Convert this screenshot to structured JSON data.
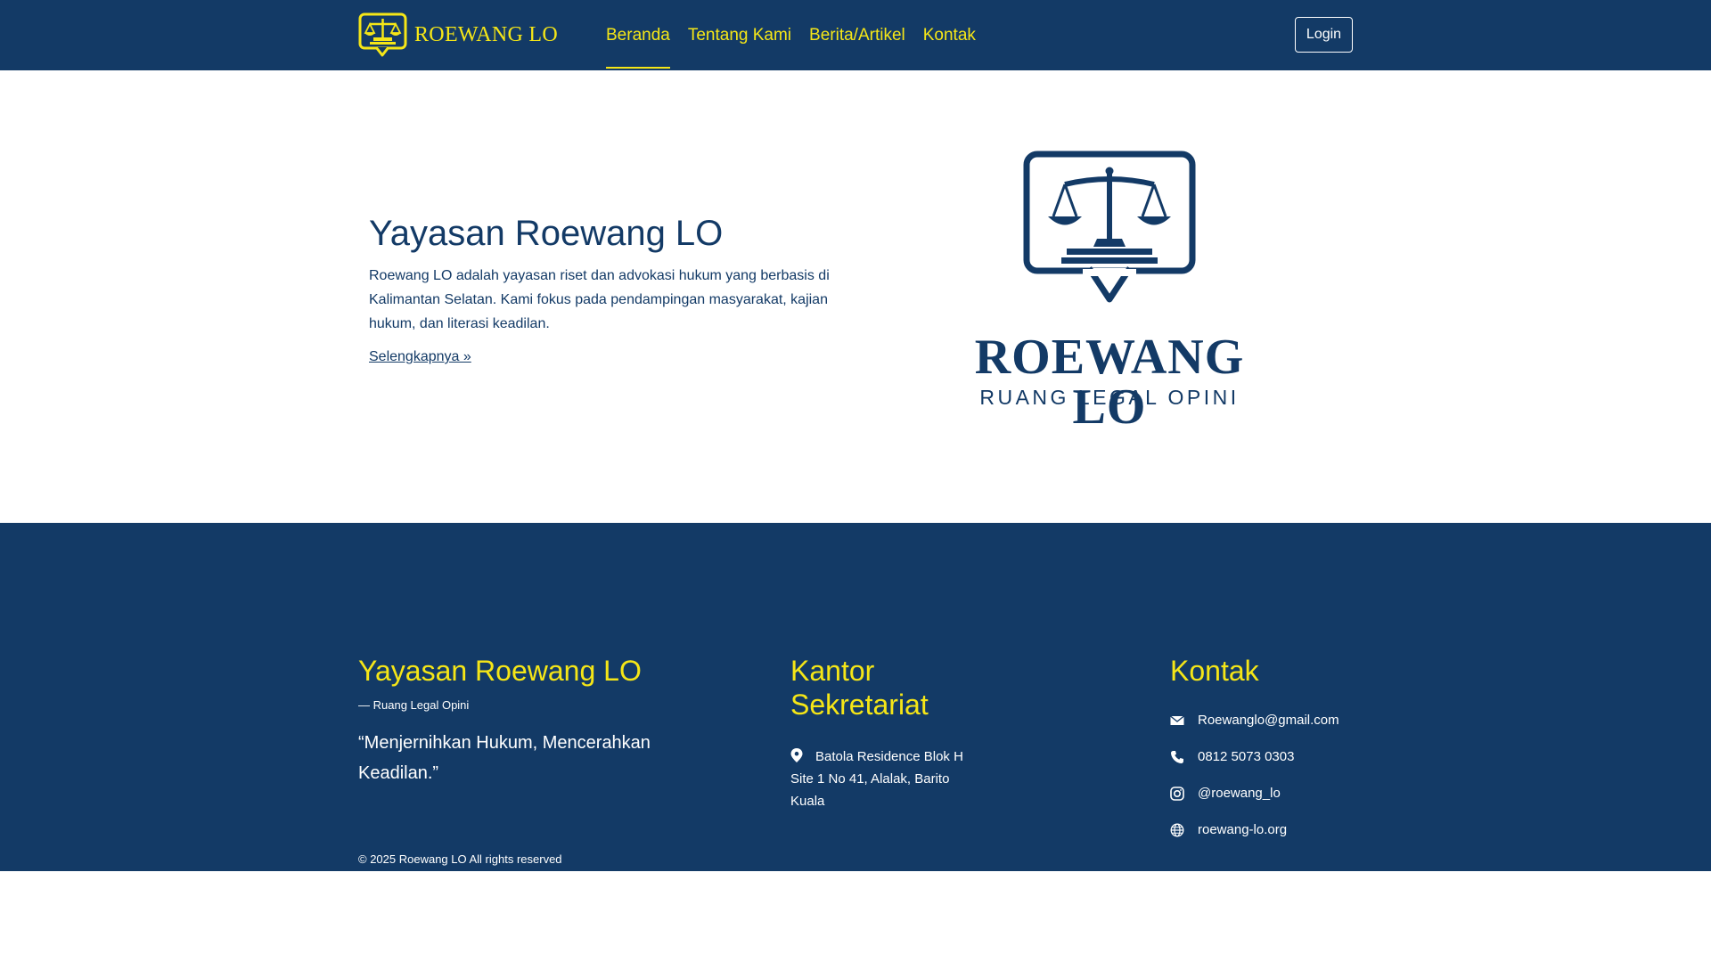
{
  "colors": {
    "primary": "#133a66",
    "accent": "#f5e617",
    "text_light": "#ffffff"
  },
  "navbar": {
    "brand": "ROEWANG LO",
    "brand_icon": "scales-speech-bubble-icon",
    "links": [
      {
        "label": "Beranda",
        "active": true
      },
      {
        "label": "Tentang Kami",
        "active": false
      },
      {
        "label": "Berita/Artikel",
        "active": false
      },
      {
        "label": "Kontak",
        "active": false
      }
    ],
    "login_label": "Login"
  },
  "hero": {
    "title": "Yayasan Roewang LO",
    "description": "Roewang LO adalah yayasan riset dan advokasi hukum yang berbasis di Kalimantan Selatan. Kami fokus pada pendampingan masyarakat, kajian hukum, dan literasi keadilan.",
    "more_label": "Selengkapnya »",
    "logo_title": "ROEWANG LO",
    "logo_subtitle": "RUANG LEGAL OPINI"
  },
  "footer": {
    "about": {
      "heading": "Yayasan Roewang LO",
      "tagline": "— Ruang Legal Opini",
      "quote": "“Menjernihkan Hukum, Mencerahkan Keadilan.”"
    },
    "office": {
      "heading": "Kantor Sekretariat",
      "address": "Batola Residence Blok H Site 1 No 41, Alalak, Barito Kuala",
      "address_icon": "map-pin-icon"
    },
    "contact": {
      "heading": "Kontak",
      "items": [
        {
          "icon": "email-icon",
          "value": "Roewanglo@gmail.com"
        },
        {
          "icon": "phone-icon",
          "value": "0812 5073 0303"
        },
        {
          "icon": "instagram-icon",
          "value": "@roewang_lo"
        },
        {
          "icon": "globe-icon",
          "value": "roewang-lo.org"
        }
      ]
    },
    "copyright": "© 2025 Roewang LO All rights reserved"
  }
}
